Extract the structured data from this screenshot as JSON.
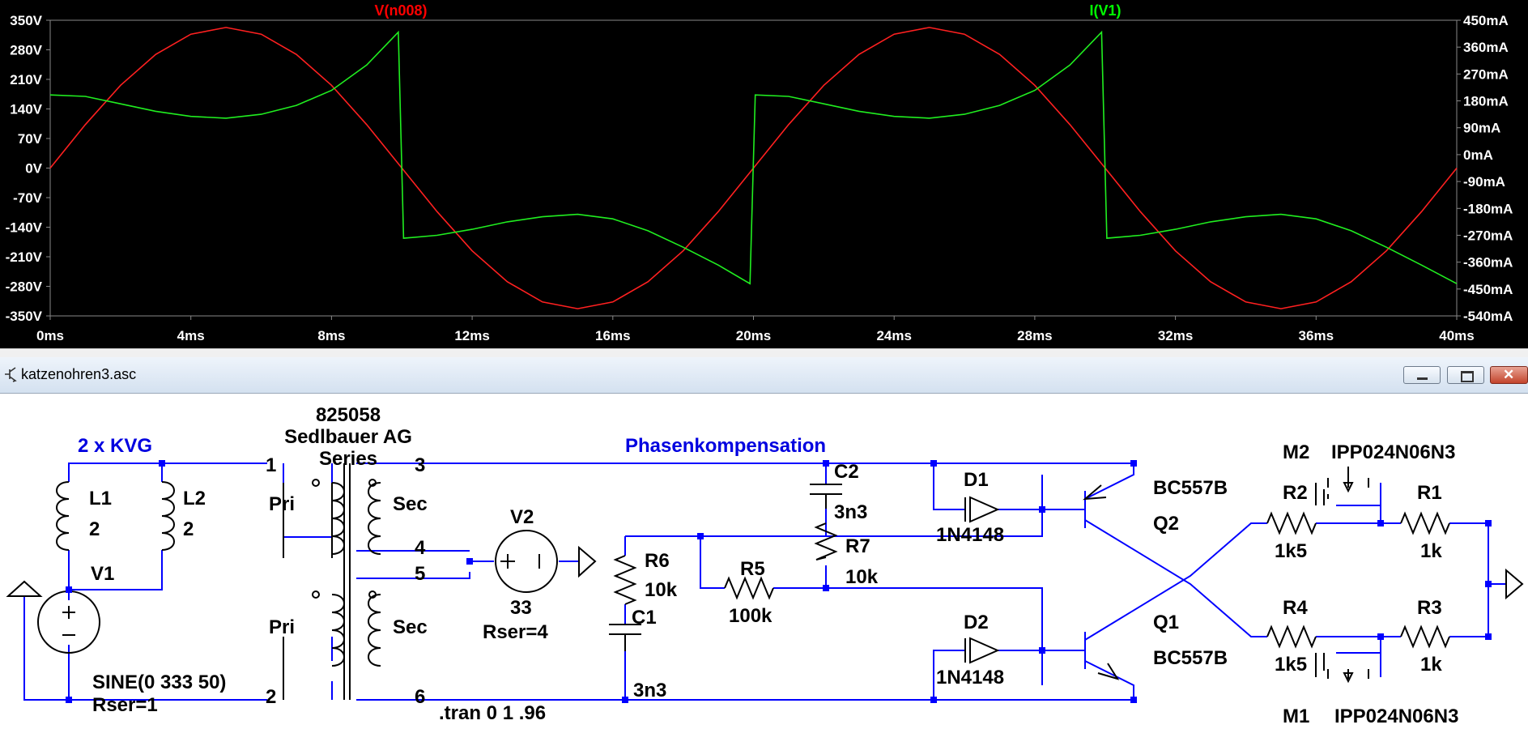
{
  "window_title": "katzenohren3.asc",
  "plot": {
    "traces": [
      {
        "name": "V(n008)",
        "color": "#ff0000"
      },
      {
        "name": "I(V1)",
        "color": "#00ff00"
      }
    ],
    "x_ticks": [
      "0ms",
      "4ms",
      "8ms",
      "12ms",
      "16ms",
      "20ms",
      "24ms",
      "28ms",
      "32ms",
      "36ms",
      "40ms"
    ],
    "y_left_ticks": [
      "350V",
      "280V",
      "210V",
      "140V",
      "70V",
      "0V",
      "-70V",
      "-140V",
      "-210V",
      "-280V",
      "-350V"
    ],
    "y_right_ticks": [
      "450mA",
      "360mA",
      "270mA",
      "180mA",
      "90mA",
      "0mA",
      "-90mA",
      "-180mA",
      "-270mA",
      "-360mA",
      "-450mA",
      "-540mA"
    ]
  },
  "chart_data": {
    "type": "line",
    "x_unit": "ms",
    "xlim": [
      0,
      40
    ],
    "ylim_left": [
      -350,
      350
    ],
    "ylim_right": [
      -540,
      450
    ],
    "series": [
      {
        "name": "V(n008)",
        "axis": "left",
        "color": "#ff0000",
        "x": [
          0,
          1,
          2,
          3,
          4,
          5,
          6,
          7,
          8,
          9,
          10,
          11,
          12,
          13,
          14,
          15,
          16,
          17,
          18,
          19,
          20,
          21,
          22,
          23,
          24,
          25,
          26,
          27,
          28,
          29,
          30,
          31,
          32,
          33,
          34,
          35,
          36,
          37,
          38,
          39,
          40
        ],
        "y": [
          0,
          103,
          196,
          269,
          317,
          333,
          317,
          269,
          196,
          103,
          0,
          -103,
          -196,
          -269,
          -317,
          -333,
          -317,
          -269,
          -196,
          -103,
          0,
          103,
          196,
          269,
          317,
          333,
          317,
          269,
          196,
          103,
          0,
          -103,
          -196,
          -269,
          -317,
          -333,
          -317,
          -269,
          -196,
          -103,
          0
        ]
      },
      {
        "name": "I(V1)",
        "axis": "right",
        "color": "#00ff00",
        "x": [
          0,
          1,
          2,
          3,
          4,
          5,
          6,
          7,
          8,
          9,
          9.9,
          10.05,
          11,
          12,
          13,
          14,
          15,
          16,
          17,
          18,
          19,
          19.9,
          20.05,
          21,
          22,
          23,
          24,
          25,
          26,
          27,
          28,
          29,
          29.9,
          30.05,
          31,
          32,
          33,
          34,
          35,
          36,
          37,
          38,
          39,
          40
        ],
        "y": [
          200,
          195,
          170,
          145,
          128,
          122,
          135,
          165,
          215,
          300,
          410,
          -280,
          -270,
          -250,
          -225,
          -208,
          -200,
          -215,
          -255,
          -310,
          -370,
          -432,
          200,
          195,
          170,
          145,
          128,
          122,
          135,
          165,
          215,
          300,
          410,
          -280,
          -270,
          -250,
          -225,
          -208,
          -200,
          -215,
          -255,
          -310,
          -370,
          -432
        ]
      }
    ]
  },
  "schematic": {
    "labels": {
      "kvg": "2 x KVG",
      "part_no": "825058",
      "maker": "Sedlbauer AG",
      "series": "Series",
      "phase": "Phasenkompensation",
      "tran": ".tran 0 1 .96",
      "l1": "L1",
      "l1v": "2",
      "l2": "L2",
      "l2v": "2",
      "v1": "V1",
      "v1v": "SINE(0 333 50)",
      "v1r": "Rser=1",
      "pri1": "Pri",
      "pri2": "Pri",
      "sec1": "Sec",
      "sec2": "Sec",
      "p1": "1",
      "p2": "2",
      "p3": "3",
      "p4": "4",
      "p5": "5",
      "p6": "6",
      "v2": "V2",
      "v2v": "33",
      "v2r": "Rser=4",
      "r6": "R6",
      "r6v": "10k",
      "c1": "C1",
      "c1v": "3n3",
      "r5": "R5",
      "r5v": "100k",
      "c2": "C2",
      "c2v": "3n3",
      "r7": "R7",
      "r7v": "10k",
      "d1": "D1",
      "d1v": "1N4148",
      "d2": "D2",
      "d2v": "1N4148",
      "q2t": "BC557B",
      "q2": "Q2",
      "q1": "Q1",
      "q1t": "BC557B",
      "r2": "R2",
      "r2v": "1k5",
      "r1": "R1",
      "r1v": "1k",
      "r4": "R4",
      "r4v": "1k5",
      "r3": "R3",
      "r3v": "1k",
      "m2": "M2",
      "m2v": "IPP024N06N3",
      "m1": "M1",
      "m1v": "IPP024N06N3"
    }
  }
}
